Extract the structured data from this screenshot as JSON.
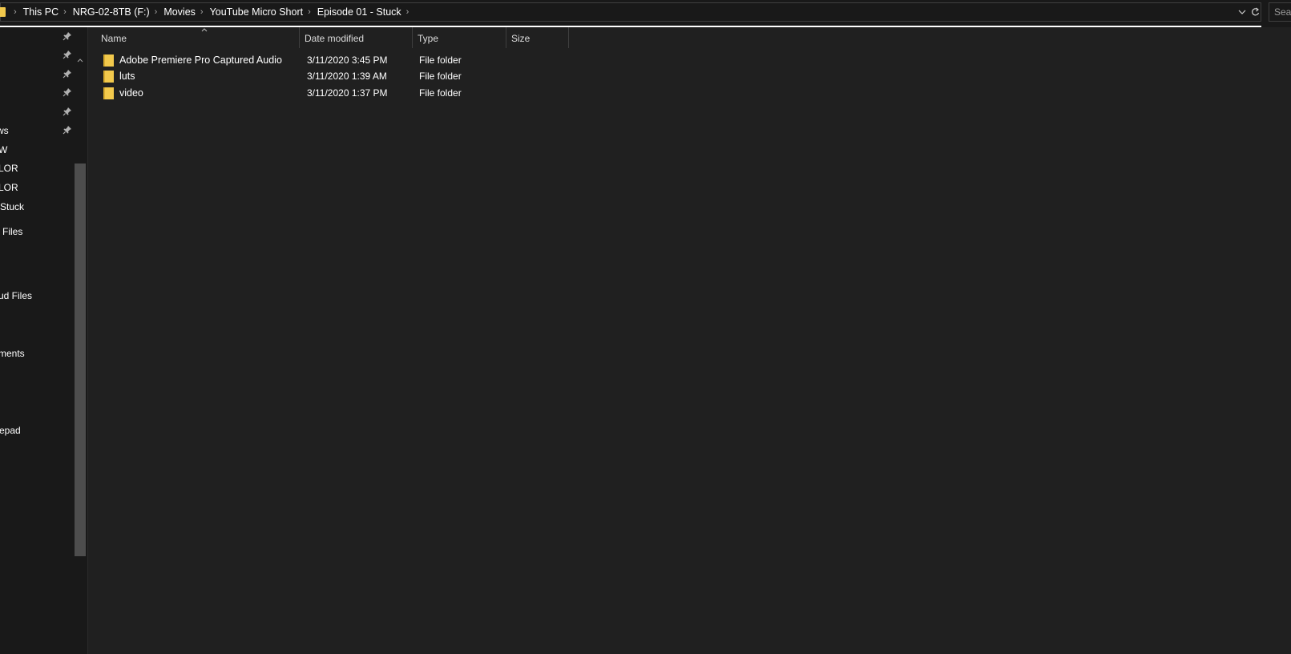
{
  "address_bar": {
    "breadcrumbs": [
      "This PC",
      "NRG-02-8TB (F:)",
      "Movies",
      "YouTube Micro Short",
      "Episode 01 - Stuck"
    ],
    "dropdown_icon": "chevron-down-icon",
    "refresh_icon": "refresh-icon"
  },
  "search": {
    "placeholder": "Sea"
  },
  "nav": {
    "items": [
      {
        "label": "",
        "pinned": true
      },
      {
        "label": "",
        "pinned": true
      },
      {
        "label": "",
        "pinned": true
      },
      {
        "label": "",
        "pinned": true
      },
      {
        "label": "",
        "pinned": true
      },
      {
        "label": "ws",
        "pinned": true
      },
      {
        "label": "W",
        "pinned": false
      },
      {
        "label": "LOR",
        "pinned": false
      },
      {
        "label": "LOR",
        "pinned": false
      },
      {
        "label": "Stuck",
        "pinned": false
      },
      {
        "label": "l Files",
        "pinned": false
      },
      {
        "label": "ud Files",
        "pinned": false
      },
      {
        "label": "ments",
        "pinned": false
      },
      {
        "label": "epad",
        "pinned": false
      }
    ]
  },
  "columns": {
    "name": "Name",
    "date_modified": "Date modified",
    "type": "Type",
    "size": "Size"
  },
  "files": [
    {
      "name": "Adobe Premiere Pro Captured Audio",
      "date_modified": "3/11/2020 3:45 PM",
      "type": "File folder",
      "size": ""
    },
    {
      "name": "luts",
      "date_modified": "3/11/2020 1:39 AM",
      "type": "File folder",
      "size": ""
    },
    {
      "name": "video",
      "date_modified": "3/11/2020 1:37 PM",
      "type": "File folder",
      "size": ""
    }
  ],
  "colors": {
    "folder": "#f2c94c",
    "background": "#202020",
    "nav_background": "#191919"
  }
}
